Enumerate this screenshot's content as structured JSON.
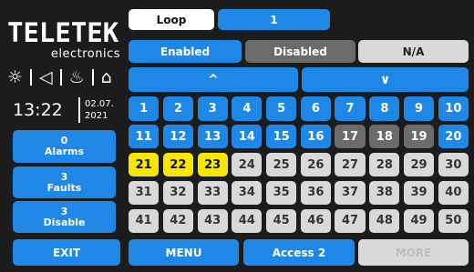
{
  "logo": {
    "brand": "TELETEK",
    "sub": "electronics"
  },
  "status": {
    "time": "13:22",
    "date_line1": "02.07.",
    "date_line2": "2021"
  },
  "tabs": {
    "loop_label": "Loop",
    "loop_value": "1"
  },
  "filters": {
    "enabled": "Enabled",
    "disabled": "Disabled",
    "na": "N/A"
  },
  "scroll": {
    "up": "^",
    "down": "∨"
  },
  "side": {
    "alarms_count": "0",
    "alarms_label": "Alarms",
    "faults_count": "3",
    "faults_label": "Faults",
    "disable_count": "3",
    "disable_label": "Disable"
  },
  "grid": {
    "cells": [
      {
        "n": "1",
        "s": "blue"
      },
      {
        "n": "2",
        "s": "blue"
      },
      {
        "n": "3",
        "s": "blue"
      },
      {
        "n": "4",
        "s": "blue"
      },
      {
        "n": "5",
        "s": "blue"
      },
      {
        "n": "6",
        "s": "blue"
      },
      {
        "n": "7",
        "s": "blue"
      },
      {
        "n": "8",
        "s": "blue"
      },
      {
        "n": "9",
        "s": "blue"
      },
      {
        "n": "10",
        "s": "blue"
      },
      {
        "n": "11",
        "s": "blue"
      },
      {
        "n": "12",
        "s": "blue"
      },
      {
        "n": "13",
        "s": "blue"
      },
      {
        "n": "14",
        "s": "blue"
      },
      {
        "n": "15",
        "s": "blue"
      },
      {
        "n": "16",
        "s": "blue"
      },
      {
        "n": "17",
        "s": "gray"
      },
      {
        "n": "18",
        "s": "gray"
      },
      {
        "n": "19",
        "s": "gray"
      },
      {
        "n": "20",
        "s": "blue"
      },
      {
        "n": "21",
        "s": "yellow"
      },
      {
        "n": "22",
        "s": "yellow"
      },
      {
        "n": "23",
        "s": "yellow"
      },
      {
        "n": "24",
        "s": "light"
      },
      {
        "n": "25",
        "s": "light"
      },
      {
        "n": "26",
        "s": "light"
      },
      {
        "n": "27",
        "s": "light"
      },
      {
        "n": "28",
        "s": "light"
      },
      {
        "n": "29",
        "s": "light"
      },
      {
        "n": "30",
        "s": "light"
      },
      {
        "n": "31",
        "s": "light"
      },
      {
        "n": "32",
        "s": "light"
      },
      {
        "n": "33",
        "s": "light"
      },
      {
        "n": "34",
        "s": "light"
      },
      {
        "n": "35",
        "s": "light"
      },
      {
        "n": "36",
        "s": "light"
      },
      {
        "n": "37",
        "s": "light"
      },
      {
        "n": "38",
        "s": "light"
      },
      {
        "n": "39",
        "s": "light"
      },
      {
        "n": "40",
        "s": "light"
      },
      {
        "n": "41",
        "s": "light"
      },
      {
        "n": "42",
        "s": "light"
      },
      {
        "n": "43",
        "s": "light"
      },
      {
        "n": "44",
        "s": "light"
      },
      {
        "n": "45",
        "s": "light"
      },
      {
        "n": "46",
        "s": "light"
      },
      {
        "n": "47",
        "s": "light"
      },
      {
        "n": "48",
        "s": "light"
      },
      {
        "n": "49",
        "s": "light"
      },
      {
        "n": "50",
        "s": "light"
      }
    ]
  },
  "bottom": {
    "exit": "EXIT",
    "menu": "MENU",
    "access": "Access 2",
    "more": "MORE"
  },
  "colors": {
    "blue": "#1f87e5",
    "gray": "#6b6b6b",
    "light": "#d9d9d9",
    "yellow": "#f7e600",
    "background": "#1c1c1c"
  }
}
